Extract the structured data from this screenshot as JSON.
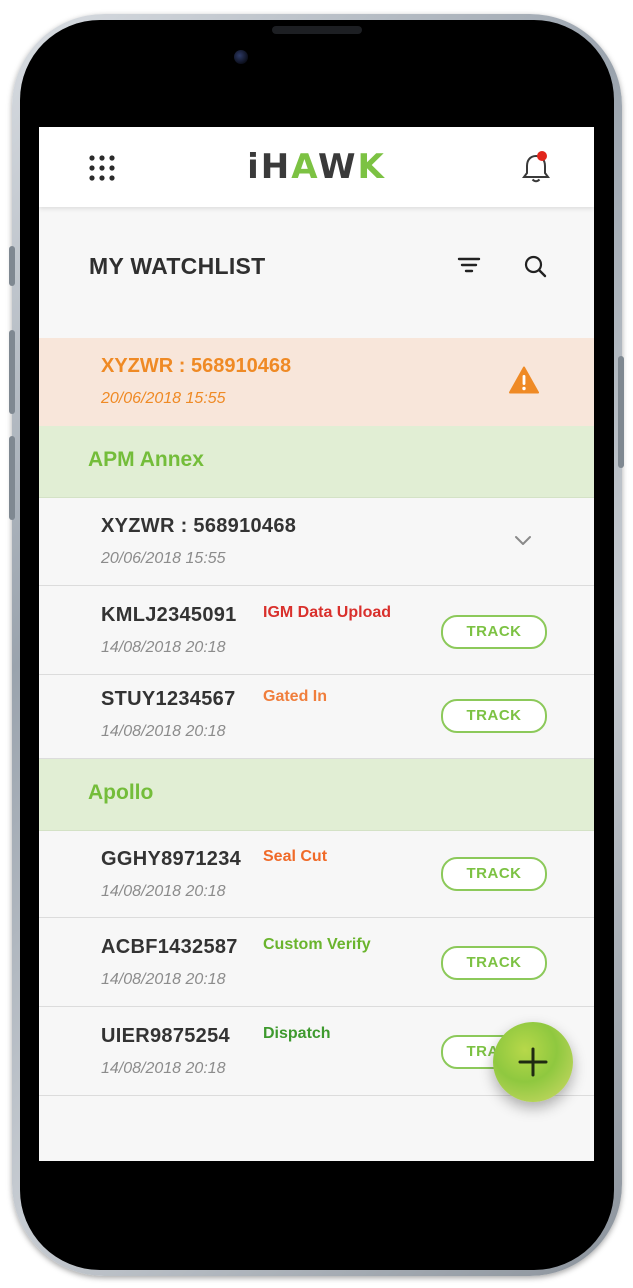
{
  "app": {
    "logo_part1": "iH",
    "logo_part2": "A",
    "logo_part3": "W",
    "logo_part4": "K"
  },
  "header": {
    "menu_icon": "grid-dots-icon",
    "notification_icon": "bell-icon",
    "notification_dot_color": "#e1251b"
  },
  "page": {
    "title": "MY WATCHLIST",
    "filter_icon": "filter-icon",
    "search_icon": "search-icon"
  },
  "alert": {
    "title": "XYZWR : 568910468",
    "date": "20/06/2018  15:55",
    "icon": "warning-triangle-icon",
    "color": "#ef8a25"
  },
  "groups": [
    {
      "name": "APM Annex",
      "items": [
        {
          "id": "XYZWR : 568910468",
          "date": "20/06/2018  15:55",
          "status": "",
          "action": "expand"
        },
        {
          "id": "KMLJ2345091",
          "date": "14/08/2018  20:18",
          "status": "IGM Data Upload",
          "status_color": "#d9302c",
          "action": "TRACK"
        },
        {
          "id": "STUY1234567",
          "date": "14/08/2018  20:18",
          "status": "Gated In",
          "status_color": "#f07e3c",
          "action": "TRACK"
        }
      ]
    },
    {
      "name": "Apollo",
      "items": [
        {
          "id": "GGHY8971234",
          "date": "14/08/2018  20:18",
          "status": "Seal Cut",
          "status_color": "#f06a28",
          "action": "TRACK"
        },
        {
          "id": "ACBF1432587",
          "date": "14/08/2018  20:18",
          "status": "Custom Verify",
          "status_color": "#6ab42d",
          "action": "TRACK"
        },
        {
          "id": "UIER9875254",
          "date": "14/08/2018  20:18",
          "status": "Dispatch",
          "status_color": "#3e9a2e",
          "action": "TRACK"
        }
      ]
    }
  ],
  "fab": {
    "icon": "plus-icon"
  },
  "colors": {
    "brand_green": "#7cc243",
    "group_bg": "#e1eed4",
    "alert_bg": "#f8e6da"
  }
}
